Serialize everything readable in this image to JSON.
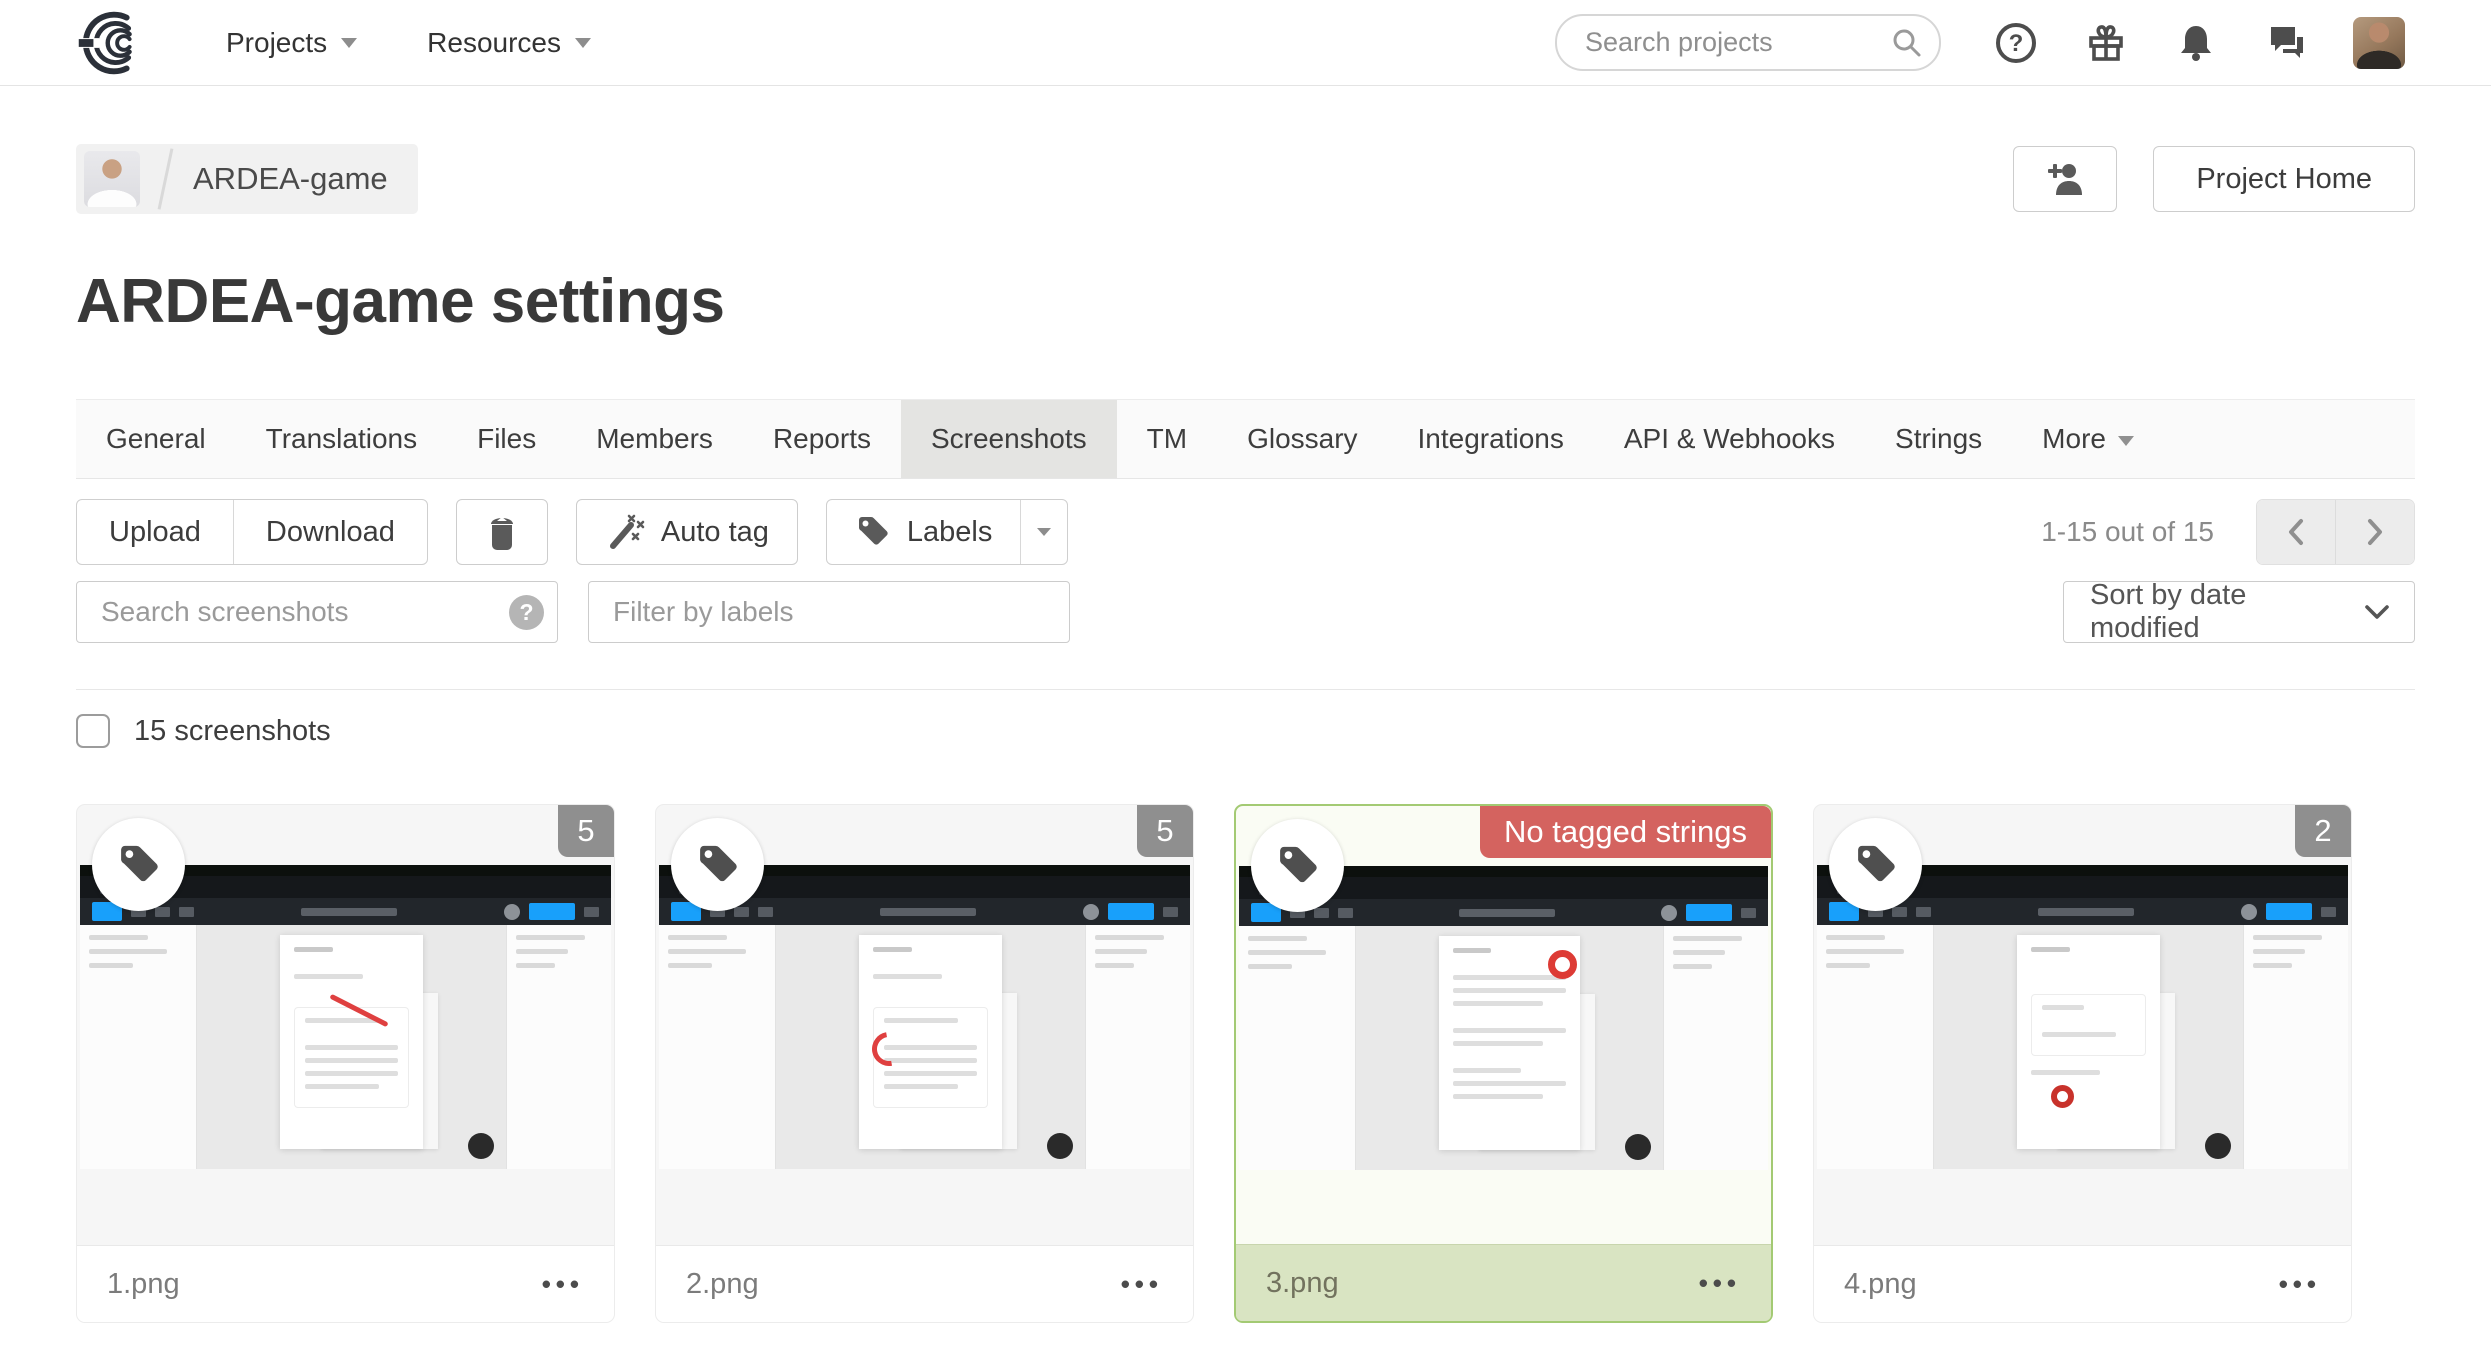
{
  "header": {
    "nav": [
      {
        "label": "Projects"
      },
      {
        "label": "Resources"
      }
    ],
    "search_placeholder": "Search projects",
    "help_glyph": "?"
  },
  "breadcrumb": {
    "project": "ARDEA-game"
  },
  "header_actions": {
    "project_home": "Project Home"
  },
  "page_title": "ARDEA-game settings",
  "tabs": {
    "active": "Screenshots",
    "items": [
      {
        "label": "General"
      },
      {
        "label": "Translations"
      },
      {
        "label": "Files"
      },
      {
        "label": "Members"
      },
      {
        "label": "Reports"
      },
      {
        "label": "Screenshots"
      },
      {
        "label": "TM"
      },
      {
        "label": "Glossary"
      },
      {
        "label": "Integrations"
      },
      {
        "label": "API & Webhooks"
      },
      {
        "label": "Strings"
      },
      {
        "label": "More"
      }
    ]
  },
  "toolbar": {
    "upload": "Upload",
    "download": "Download",
    "auto_tag": "Auto tag",
    "labels": "Labels",
    "range": "1-15 out of 15"
  },
  "filters": {
    "search_placeholder": "Search screenshots",
    "labels_placeholder": "Filter by labels",
    "help_glyph": "?",
    "sort": "Sort by date modified"
  },
  "selection": {
    "label": "15 screenshots"
  },
  "ui": {
    "menu_glyph": "•••"
  },
  "cards": [
    {
      "filename": "1.png",
      "badge": "5"
    },
    {
      "filename": "2.png",
      "badge": "5"
    },
    {
      "filename": "3.png",
      "badge": "No tagged strings",
      "selected": true
    },
    {
      "filename": "4.png",
      "badge": "2"
    }
  ],
  "colors": {
    "accent_blue": "#18a0fb",
    "badge_gray": "#8f8f8f",
    "badge_red": "#d4635f",
    "selected_border": "#a3ca73",
    "selected_footer": "#d9e4c2"
  }
}
